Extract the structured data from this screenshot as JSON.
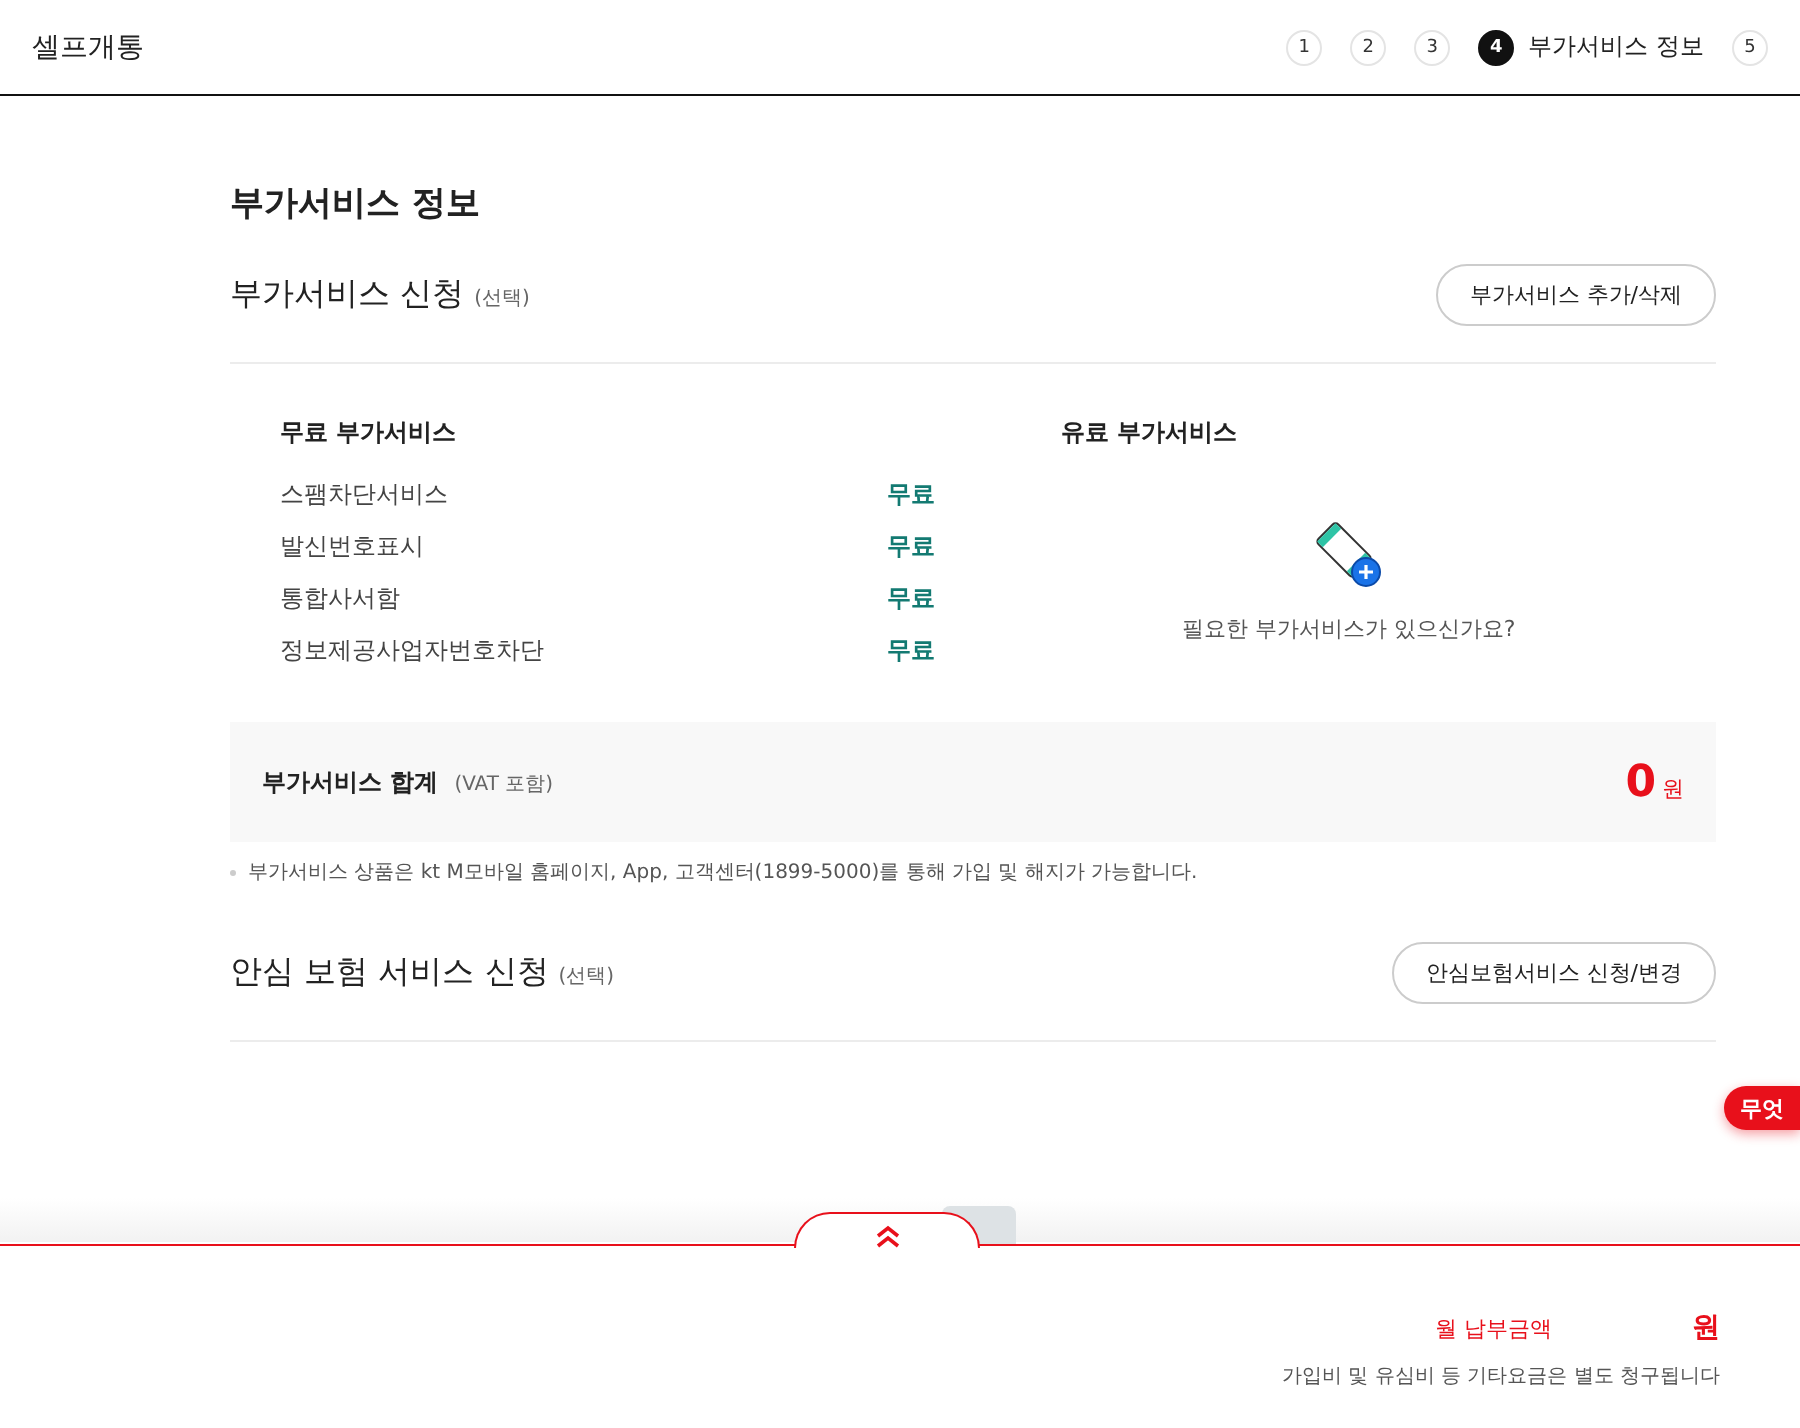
{
  "header": {
    "title": "셀프개통",
    "steps": [
      {
        "number": "1",
        "selected": false
      },
      {
        "number": "2",
        "selected": false
      },
      {
        "number": "3",
        "selected": false
      },
      {
        "number": "4",
        "label": "부가서비스 정보",
        "selected": true
      },
      {
        "number": "5",
        "selected": false
      }
    ]
  },
  "page_title": "부가서비스 정보",
  "addon_section": {
    "title": "부가서비스 신청",
    "optional": "(선택)",
    "button": "부가서비스 추가/삭제",
    "free": {
      "heading": "무료 부가서비스",
      "items": [
        {
          "name": "스팸차단서비스",
          "price": "무료"
        },
        {
          "name": "발신번호표시",
          "price": "무료"
        },
        {
          "name": "통합사서함",
          "price": "무료"
        },
        {
          "name": "정보제공사업자번호차단",
          "price": "무료"
        }
      ]
    },
    "paid": {
      "heading": "유료 부가서비스",
      "empty_text": "필요한 부가서비스가 있으신가요?"
    },
    "total": {
      "label": "부가서비스 합계",
      "note": "(VAT 포함)",
      "amount": "0",
      "unit": "원"
    },
    "notice": "부가서비스 상품은 kt M모바일 홈페이지, App, 고객센터(1899-5000)를 통해 가입 및 해지가 가능합니다."
  },
  "insurance_section": {
    "title": "안심 보험 서비스 신청",
    "optional": "(선택)",
    "button": "안심보험서비스 신청/변경"
  },
  "floating_badge": "무엇",
  "footer": {
    "label": "월 납부금액",
    "unit": "원",
    "note": "가입비 및 유심비 등 기타요금은 별도 청구됩니다"
  }
}
